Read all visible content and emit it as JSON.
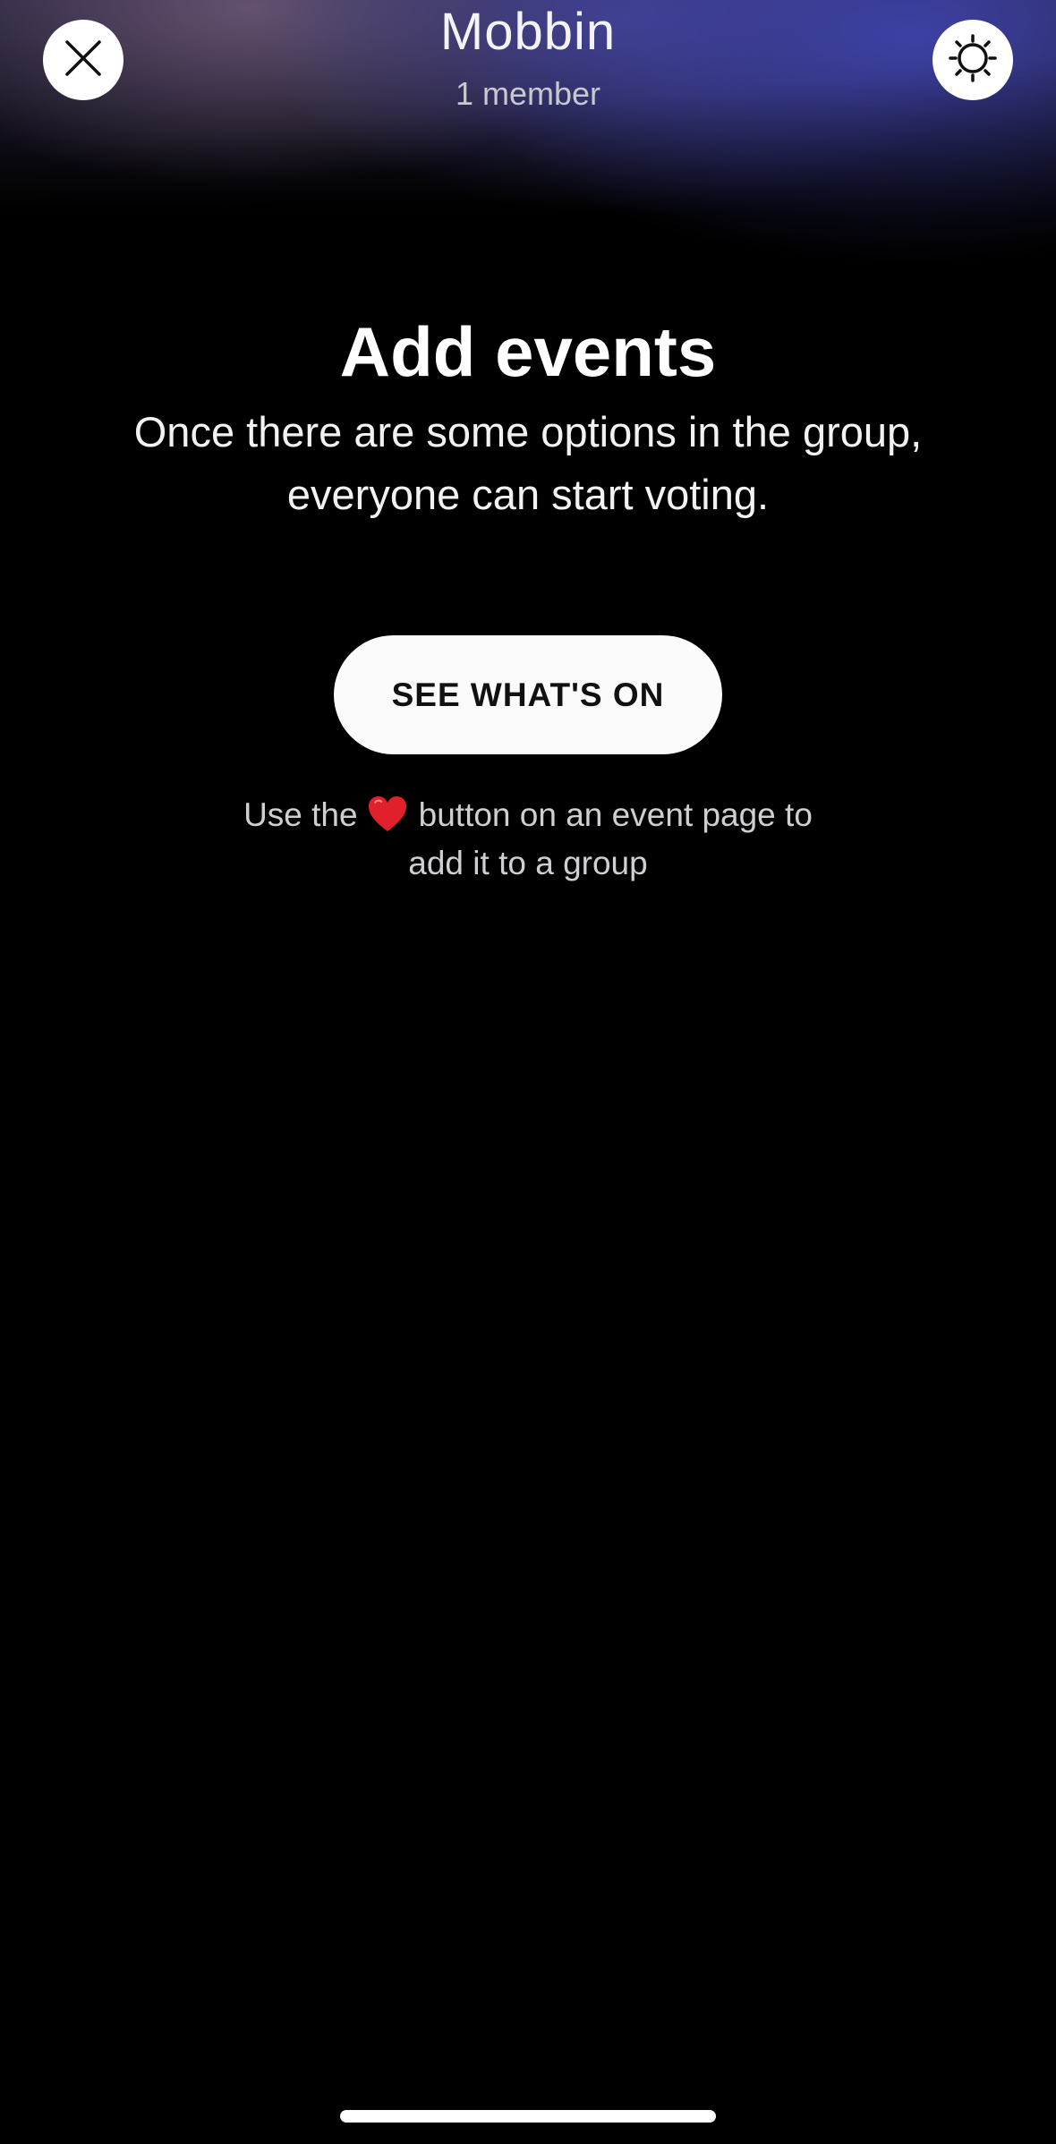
{
  "header": {
    "title": "Mobbin",
    "subtitle": "1 member",
    "close_icon": "close-icon",
    "settings_icon": "sun-gear-icon"
  },
  "empty_state": {
    "heading": "Add events",
    "description": "Once there are some options in the group, everyone can start voting.",
    "button_label": "SEE WHAT'S ON",
    "hint_before": "Use the",
    "hint_icon": "heart-icon",
    "hint_after": "button on an event page to add it to a group"
  },
  "colors": {
    "background": "#000000",
    "button_bg": "#fbfbfb",
    "heart": "#e0202a",
    "header_glow": "#3e42aa"
  }
}
